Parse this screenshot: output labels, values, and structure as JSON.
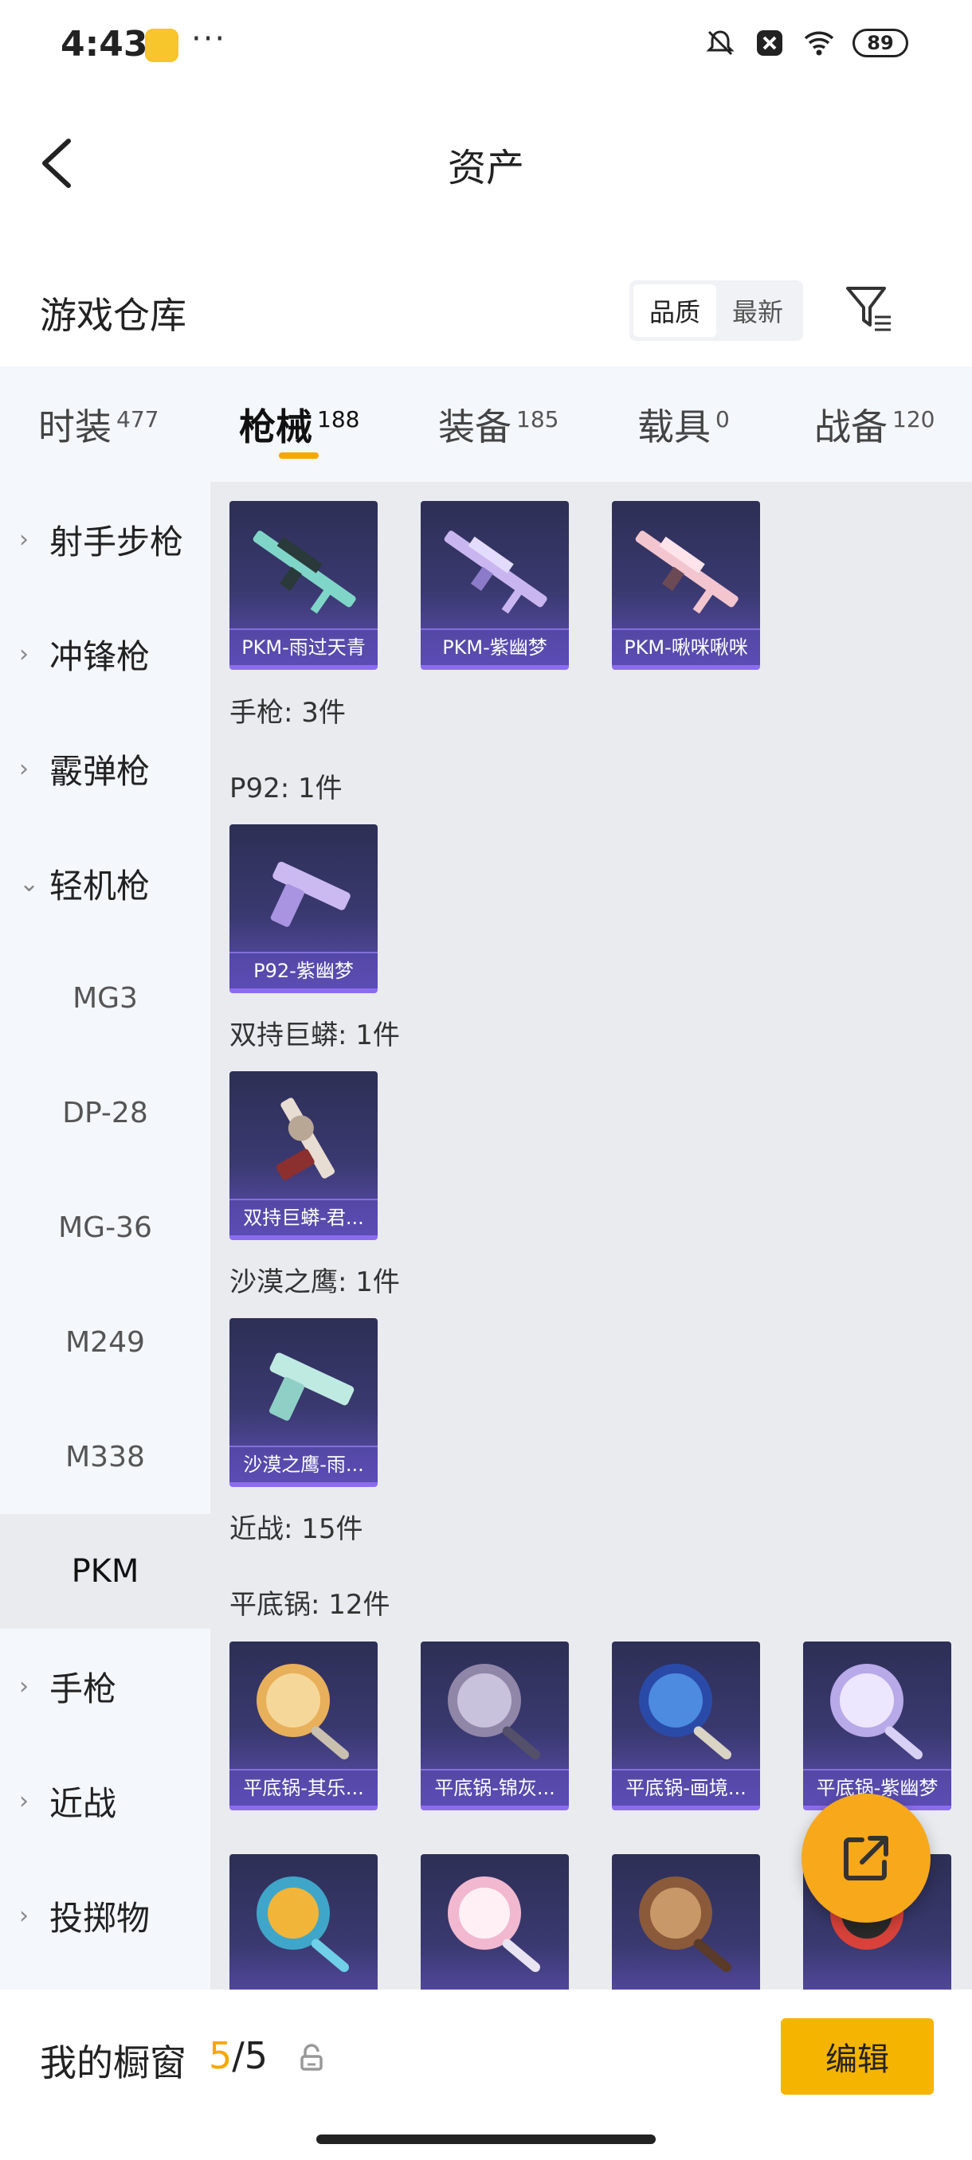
{
  "status": {
    "time": "4:43",
    "dots": "···",
    "battery": "89"
  },
  "header": {
    "title": "资产"
  },
  "warehouse": {
    "title": "游戏仓库",
    "sort_quality": "品质",
    "sort_newest": "最新"
  },
  "tabs": [
    {
      "label": "时装",
      "count": "477"
    },
    {
      "label": "枪械",
      "count": "188"
    },
    {
      "label": "装备",
      "count": "185"
    },
    {
      "label": "载具",
      "count": "0"
    },
    {
      "label": "战备",
      "count": "120"
    }
  ],
  "sidebar": {
    "categories": [
      "射手步枪",
      "冲锋枪",
      "霰弹枪",
      "轻机枪"
    ],
    "subs": [
      "MG3",
      "DP-28",
      "MG-36",
      "M249",
      "M338",
      "PKM"
    ],
    "more": [
      "手枪",
      "近战",
      "投掷物"
    ]
  },
  "content": {
    "pkm_items": [
      "PKM-雨过天青",
      "PKM-紫幽梦",
      "PKM-啾咪啾咪"
    ],
    "pistol_section": "手枪: 3件",
    "p92_section": "P92: 1件",
    "p92_items": [
      "P92-紫幽梦"
    ],
    "python_section": "双持巨蟒: 1件",
    "python_items": [
      "双持巨蟒-君..."
    ],
    "eagle_section": "沙漠之鹰: 1件",
    "eagle_items": [
      "沙漠之鹰-雨..."
    ],
    "melee_section": "近战: 15件",
    "pan_section": "平底锅: 12件",
    "pan_items": [
      "平底锅-其乐...",
      "平底锅-锦灰...",
      "平底锅-画境...",
      "平底锅-紫幽梦"
    ]
  },
  "showcase": {
    "title": "我的橱窗",
    "used": "5",
    "sep": "/",
    "total": "5",
    "edit_label": "编辑"
  },
  "colors": {
    "accent": "#f5a800",
    "card_purple": "#5e4fb3",
    "fab": "#f7a81b"
  }
}
